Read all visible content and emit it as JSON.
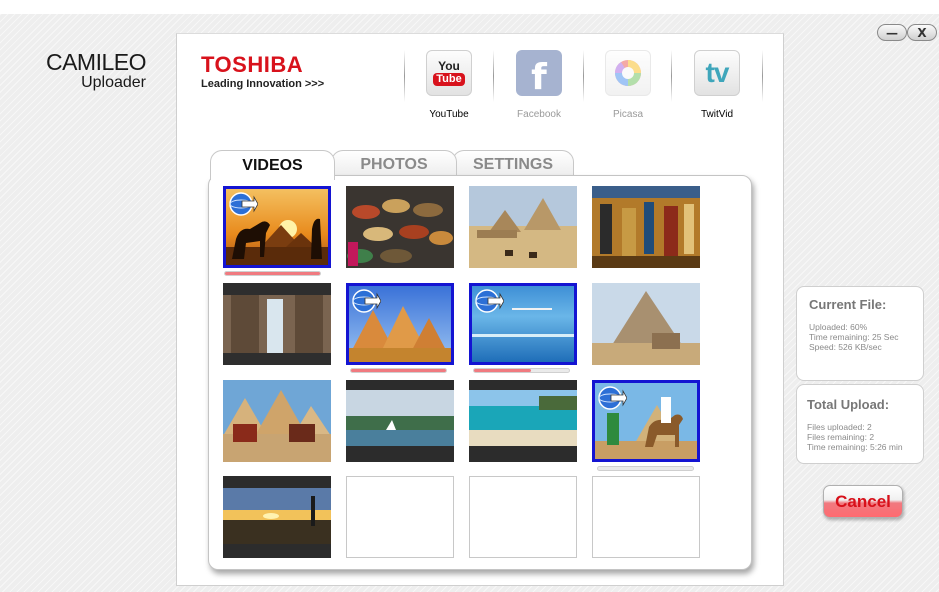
{
  "app": {
    "name_line1": "CAMILEO",
    "name_line2": "Uploader"
  },
  "window_controls": {
    "minimize": "—",
    "close": "X"
  },
  "brand": {
    "name": "TOSHIBA",
    "tagline": "Leading Innovation >>>"
  },
  "services": [
    {
      "name": "YouTube",
      "icon": "youtube-icon",
      "icon_text_1": "You",
      "icon_text_2": "Tube",
      "active": true
    },
    {
      "name": "Facebook",
      "icon": "facebook-icon",
      "icon_text_1": "f",
      "active": false
    },
    {
      "name": "Picasa",
      "icon": "picasa-icon",
      "active": false
    },
    {
      "name": "TwitVid",
      "icon": "twitvid-icon",
      "icon_text_1": "tv",
      "active": false
    }
  ],
  "tabs": [
    {
      "label": "VIDEOS",
      "active": true
    },
    {
      "label": "PHOTOS",
      "active": false
    },
    {
      "label": "SETTINGS",
      "active": false
    }
  ],
  "thumbnails": [
    {
      "scene": "camel-sunset-pyramids",
      "selected": true,
      "uploading_badge": true,
      "progress": 1.0,
      "progress_color": "#f07a80"
    },
    {
      "scene": "spice-market",
      "selected": false
    },
    {
      "scene": "pyramids-camels-desert",
      "selected": false
    },
    {
      "scene": "egyptian-wall-art",
      "selected": false
    },
    {
      "scene": "temple-columns",
      "selected": false
    },
    {
      "scene": "giza-pyramids-blue-sky",
      "selected": true,
      "uploading_badge": true,
      "progress": 1.0,
      "progress_color": "#f07a80"
    },
    {
      "scene": "sea-beach",
      "selected": true,
      "uploading_badge": true,
      "progress": 0.6,
      "progress_color": "#f07a80"
    },
    {
      "scene": "pyramid-sphinx",
      "selected": false
    },
    {
      "scene": "camels-pyramids",
      "selected": false
    },
    {
      "scene": "nile-town",
      "selected": false
    },
    {
      "scene": "turquoise-beach",
      "selected": false
    },
    {
      "scene": "rider-on-camel",
      "selected": true,
      "uploading_badge": true,
      "progress": 0.0,
      "progress_color": "#f07a80"
    },
    {
      "scene": "sunset-lake",
      "selected": false
    },
    {
      "scene": "empty",
      "selected": false
    },
    {
      "scene": "empty",
      "selected": false
    },
    {
      "scene": "empty",
      "selected": false
    }
  ],
  "current_file": {
    "title": "Current File:",
    "uploaded": "Uploaded: 60%",
    "time_remaining": "Time remaining: 25 Sec",
    "speed": "Speed: 526 KB/sec"
  },
  "total_upload": {
    "title": "Total Upload:",
    "files_uploaded": "Files uploaded:  2",
    "files_remaining": "Files remaining: 2",
    "time_remaining": "Time remaining: 5:26 min"
  },
  "cancel_button": "Cancel",
  "colors": {
    "brand_red": "#d8121c",
    "selection_blue": "#1414d2",
    "progress_pink": "#f07a80",
    "cancel_red": "#d8101a"
  }
}
